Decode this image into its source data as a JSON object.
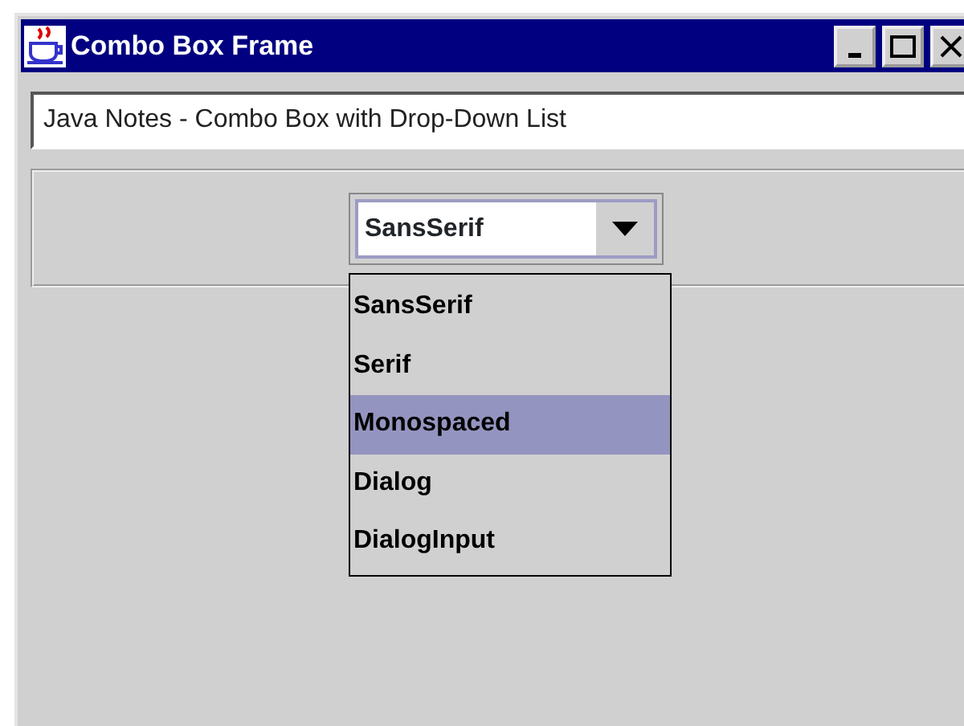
{
  "window": {
    "title": "Combo Box Frame"
  },
  "text_field": {
    "value": "Java Notes - Combo Box with Drop-Down List"
  },
  "combo_box": {
    "value": "SansSerif",
    "expanded": true
  },
  "dropdown_items": [
    {
      "label": "SansSerif",
      "selected": false
    },
    {
      "label": "Serif",
      "selected": false
    },
    {
      "label": "Monospaced",
      "selected": true
    },
    {
      "label": "Dialog",
      "selected": false
    },
    {
      "label": "DialogInput",
      "selected": false
    }
  ]
}
